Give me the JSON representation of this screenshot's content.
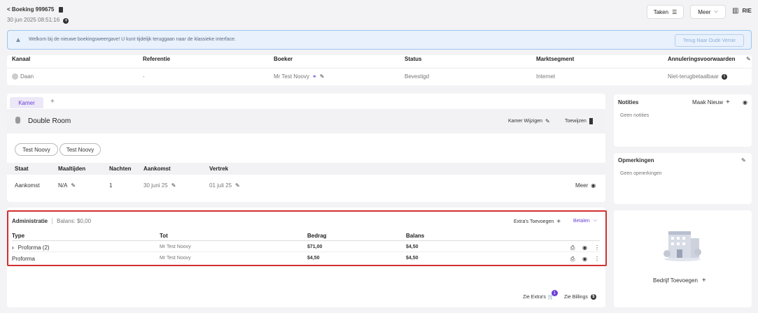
{
  "header": {
    "booking_link": "< Boeking 999675",
    "datetime": "30 jun 2025 08:51:16",
    "tasks_label": "Taken",
    "more_label": "Meer",
    "user_label": "RIE"
  },
  "banner": {
    "text": "Welkom bij de nieuwe boekingsweergave! U kunt tijdelijk teruggaan naar de klassieke interface.",
    "button_label": "Terug Naar Oude Versie"
  },
  "summary": {
    "headers": [
      "Kanaal",
      "Referentie",
      "Boeker",
      "Status",
      "Marktsegment",
      "Annuleringsvoorwaarden"
    ],
    "values": {
      "channel": "Daan",
      "reference": "-",
      "booker": "Mr Test Noovy",
      "status": "Bevestigd",
      "segment": "Internet",
      "cancellation": "Niet-terugbetaalbaar"
    }
  },
  "room": {
    "tab_label": "Kamer",
    "add_tab": "+",
    "room_name": "Double Room",
    "change_label": "Kamer Wijzigen",
    "assign_label": "Toewijzen",
    "guests": [
      "Test Noovy",
      "Test Noovy"
    ],
    "table_headers": [
      "Staat",
      "Maaltijden",
      "Nachten",
      "Aankomst",
      "Vertrek"
    ],
    "row": {
      "state": "Aankomst",
      "meals": "N/A",
      "nights": "1",
      "arrival": "30 juni 25",
      "departure": "01 juli 25",
      "more": "Meer"
    }
  },
  "administration": {
    "title": "Administratie",
    "balance": "Balans:  $0,00",
    "extras_label": "Extra's Toevoegen",
    "pay_label": "Betalen",
    "headers": [
      "Type",
      "Tot",
      "Bedrag",
      "Balans"
    ],
    "rows": [
      {
        "type": "Proforma (2)",
        "to": "Mr Test Noovy",
        "amount": "$71,00",
        "balance": "$4,50"
      },
      {
        "type": "Proforma",
        "to": "Mr Test Noovy",
        "amount": "$4,50",
        "balance": "$4,50"
      }
    ],
    "see_extras": "Zie Extra's",
    "extras_count": "1",
    "see_billings": "Zie Billings"
  },
  "notes": {
    "title": "Notities",
    "new_label": "Maak Nieuw",
    "empty": "Geen notities"
  },
  "remarks": {
    "title": "Opmerkingen",
    "empty": "Geen opmerkingen"
  },
  "company": {
    "add_label": "Bedrijf Toevoegen"
  },
  "colors": {
    "accent": "#6b3fd6",
    "banner_bg": "#e8f1fc",
    "banner_border": "#9cc4ee",
    "highlight_border": "#d32f2f"
  }
}
